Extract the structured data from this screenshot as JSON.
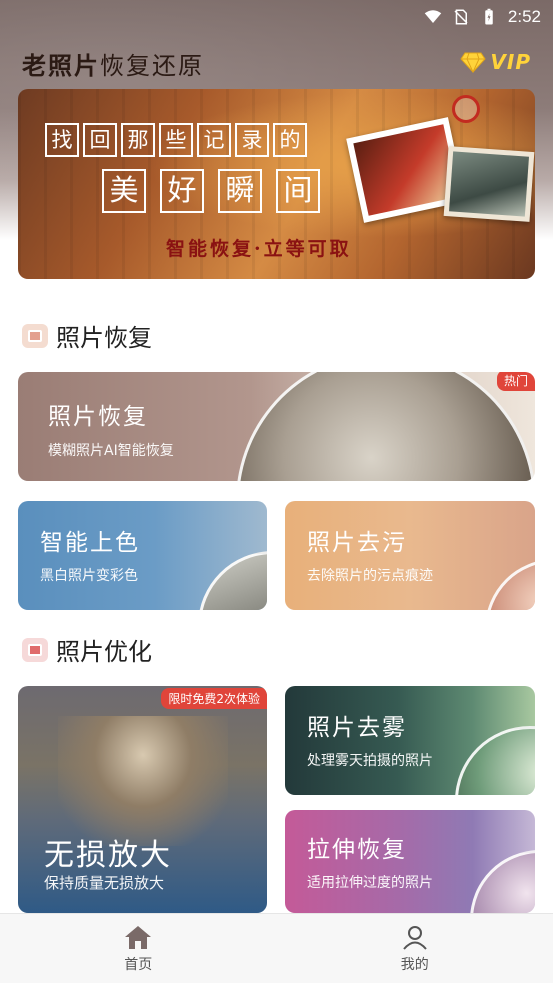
{
  "status_bar": {
    "time": "2:52"
  },
  "header": {
    "title_bold": "老照片",
    "title_light": "恢复还原",
    "vip_label": "VIP"
  },
  "hero": {
    "line1": [
      "找",
      "回",
      "那",
      "些",
      "记",
      "录",
      "的"
    ],
    "line2": [
      "美",
      "好",
      "瞬",
      "间"
    ],
    "subtitle": "智能恢复·立等可取"
  },
  "sections": {
    "restore": {
      "title": "照片恢复"
    },
    "optimize": {
      "title": "照片优化"
    }
  },
  "cards": {
    "photo_restore": {
      "title": "照片恢复",
      "desc": "模糊照片AI智能恢复",
      "tag": "热门"
    },
    "colorize": {
      "title": "智能上色",
      "desc": "黑白照片变彩色"
    },
    "stain_removal": {
      "title": "照片去污",
      "desc": "去除照片的污点痕迹"
    },
    "upscale": {
      "title": "无损放大",
      "desc": "保持质量无损放大",
      "tag": "限时免费2次体验"
    },
    "dehaze": {
      "title": "照片去雾",
      "desc": "处理雾天拍摄的照片"
    },
    "stretch": {
      "title": "拉伸恢复",
      "desc": "适用拉伸过度的照片"
    }
  },
  "bottom_nav": {
    "home": "首页",
    "mine": "我的"
  },
  "colors": {
    "accent_red": "#e0453a",
    "vip_gold": "#ffd33a"
  }
}
